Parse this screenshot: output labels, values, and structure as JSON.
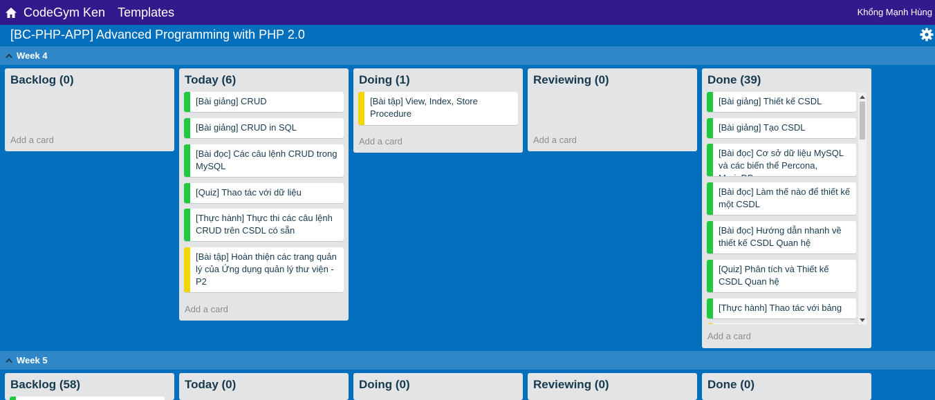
{
  "nav": {
    "brand": "CodeGym Ken",
    "templates": "Templates",
    "user": "Khổng Mạnh Hùng"
  },
  "board": {
    "title": "[BC-PHP-APP] Advanced Programming with PHP 2.0"
  },
  "colors": {
    "green": "#1ec940",
    "yellow": "#f2d600",
    "nav_bg": "#331a8c",
    "board_bg": "#0470bd"
  },
  "weeks": [
    {
      "label": "Week 4",
      "lists": [
        {
          "title": "Backlog (0)",
          "add": "Add a card",
          "cards": []
        },
        {
          "title": "Today (6)",
          "add": "Add a card",
          "cards": [
            {
              "text": "[Bài giảng] CRUD",
              "label": "green"
            },
            {
              "text": "[Bài giảng] CRUD in SQL",
              "label": "green"
            },
            {
              "text": "[Bài đọc] Các câu lệnh CRUD trong MySQL",
              "label": "green"
            },
            {
              "text": "[Quiz] Thao tác với dữ liệu",
              "label": "green"
            },
            {
              "text": "[Thực hành] Thực thi các câu lệnh CRUD trên CSDL có sẵn",
              "label": "green"
            },
            {
              "text": "[Bài tập] Hoàn thiện các trang quản lý của Ứng dụng quản lý thư viện - P2",
              "label": "yellow"
            }
          ]
        },
        {
          "title": "Doing (1)",
          "add": "Add a card",
          "cards": [
            {
              "text": "[Bài tập] View, Index, Store Procedure",
              "label": "yellow"
            }
          ]
        },
        {
          "title": "Reviewing (0)",
          "add": "Add a card",
          "cards": []
        },
        {
          "title": "Done (39)",
          "add": "Add a card",
          "cards": [
            {
              "text": "[Bài giảng] Thiết kế CSDL",
              "label": "green"
            },
            {
              "text": "[Bài giảng] Tạo CSDL",
              "label": "green"
            },
            {
              "text": "[Bài đọc] Cơ sở dữ liệu MySQL và các biến thể Percona, MariaDB",
              "label": "green"
            },
            {
              "text": "[Bài đọc] Làm thế nào để thiết kế một CSDL",
              "label": "green"
            },
            {
              "text": "[Bài đọc] Hướng dẫn nhanh về thiết kế CSDL Quan hệ",
              "label": "green"
            },
            {
              "text": "[Quiz] Phân tích và Thiết kế CSDL Quan hệ",
              "label": "green"
            },
            {
              "text": "[Thực hành] Thao tác với bảng",
              "label": "green"
            }
          ]
        }
      ]
    },
    {
      "label": "Week 5",
      "lists": [
        {
          "title": "Backlog (58)"
        },
        {
          "title": "Today (0)"
        },
        {
          "title": "Doing (0)"
        },
        {
          "title": "Reviewing (0)"
        },
        {
          "title": "Done (0)"
        }
      ]
    }
  ]
}
